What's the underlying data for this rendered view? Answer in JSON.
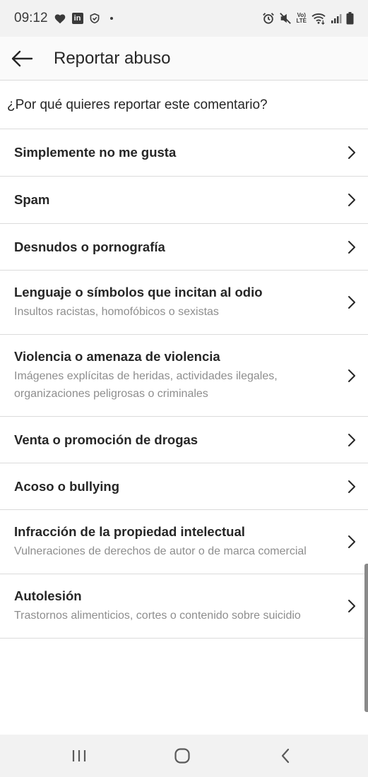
{
  "status_bar": {
    "time": "09:12",
    "icons_left": [
      "heart-icon",
      "linkedin-icon",
      "location-shield-icon",
      "dot-icon"
    ],
    "icons_right": [
      "alarm-icon",
      "mute-icon",
      "volte-icon",
      "wifi-icon",
      "signal-icon",
      "battery-icon"
    ],
    "linkedin_text": "in",
    "volte_top": "Vo)",
    "volte_bottom": "LTE"
  },
  "header": {
    "title": "Reportar abuso",
    "back_icon": "arrow-left-icon"
  },
  "question": "¿Por qué quieres reportar este comentario?",
  "reasons": [
    {
      "title": "Simplemente no me gusta",
      "subtitle": ""
    },
    {
      "title": "Spam",
      "subtitle": ""
    },
    {
      "title": "Desnudos o pornografía",
      "subtitle": ""
    },
    {
      "title": "Lenguaje o símbolos que incitan al odio",
      "subtitle": "Insultos racistas, homofóbicos o sexistas"
    },
    {
      "title": "Violencia o amenaza de violencia",
      "subtitle": "Imágenes explícitas de heridas, actividades ilegales, organizaciones peligrosas o criminales"
    },
    {
      "title": "Venta o promoción de drogas",
      "subtitle": ""
    },
    {
      "title": "Acoso o bullying",
      "subtitle": ""
    },
    {
      "title": "Infracción de la propiedad intelectual",
      "subtitle": "Vulneraciones de derechos de autor o de marca comercial"
    },
    {
      "title": "Autolesión",
      "subtitle": "Trastornos alimenticios, cortes o contenido sobre suicidio"
    }
  ],
  "nav_bar": {
    "icons": [
      "recent-apps-icon",
      "home-icon",
      "back-icon"
    ]
  },
  "colors": {
    "text_primary": "#262626",
    "text_secondary": "#8e8e8e",
    "divider": "#dbdbdb",
    "system_bar": "#f2f2f2"
  }
}
